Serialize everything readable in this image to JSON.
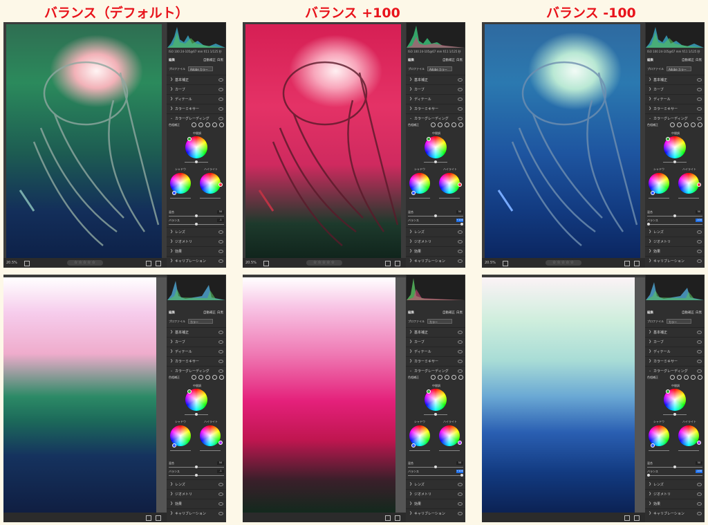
{
  "titles": [
    "バランス（デフォルト）",
    "バランス +100",
    "バランス -100"
  ],
  "sidebar": {
    "meta": "ISO 100   24-105@67 mm   f/11   1/125 秒",
    "edit_label": "編集",
    "auto_label": "自動補正",
    "bw_label": "白黒",
    "profile_label": "プロファイル",
    "profile_value_top": "Adobe カラー",
    "profile_value_bottom": "カラー",
    "sections": [
      "基本補正",
      "カーブ",
      "ディテール",
      "カラーミキサー",
      "カラーグレーディング"
    ],
    "sections_after": [
      "レンズ",
      "ジオメトリ",
      "効果",
      "キャリブレーション"
    ],
    "mode_label": "色相補正",
    "midtone_label": "中間調",
    "shadow_label": "シャドウ",
    "highlight_label": "ハイライト",
    "blend_label": "混合",
    "blend_value": "50",
    "balance_label": "バランス",
    "balance_values": [
      "-1",
      "+100",
      "-100"
    ]
  },
  "statusbar": {
    "zoom": "20.5%",
    "stars": "☆☆☆☆☆"
  },
  "colors": {
    "title": "#e8131b",
    "background": "#fdf8e8",
    "panel": "#3b3b3b"
  }
}
